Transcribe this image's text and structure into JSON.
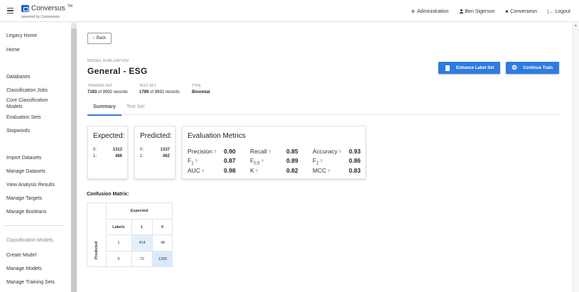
{
  "header": {
    "brand": "Conversus",
    "trademark": "TM",
    "powered_by": "powered by Converseon",
    "nav": [
      {
        "icon": "gear-icon",
        "glyph": "⚙",
        "label": "Administration"
      },
      {
        "icon": "user-icon",
        "glyph": "👤",
        "label": "Ben Sigerson"
      },
      {
        "icon": "briefcase-icon",
        "glyph": "■",
        "label": "Converseon"
      },
      {
        "icon": "logout-icon",
        "glyph": "[→",
        "label": "Logout"
      }
    ]
  },
  "sidebar": {
    "items": [
      {
        "label": "Legacy Home"
      },
      {
        "label": "Home"
      },
      {
        "label": "Databases"
      },
      {
        "label": "Classification Jobs"
      },
      {
        "label": "Core Classification Models"
      },
      {
        "label": "Evaluation Sets"
      },
      {
        "label": "Stopwords"
      },
      {
        "label": "Import Datasets"
      },
      {
        "label": "Manage Datasets"
      },
      {
        "label": "View Analysis Results"
      },
      {
        "label": "Manage Targets"
      },
      {
        "label": "Manage Booleans"
      },
      {
        "label": "Classification Models"
      },
      {
        "label": "Create Model"
      },
      {
        "label": "Manage Models"
      },
      {
        "label": "Manage Training Sets"
      }
    ]
  },
  "main": {
    "back_label": "Back",
    "eyebrow": "MODEL EVALUATION",
    "title": "General - ESG",
    "enhance_label": "Enhance Label Set",
    "continue_label": "Continue Train",
    "training": {
      "label": "TRAINING SET",
      "count": "7193",
      "rest": "of 8992 records"
    },
    "test": {
      "label": "TEST SET",
      "count": "1799",
      "rest": "of 8992 records"
    },
    "type": {
      "label": "TYPE",
      "value": "Binomial"
    },
    "tabs": [
      {
        "label": "Summary"
      },
      {
        "label": "Test Set"
      }
    ]
  },
  "expected": {
    "title": "Expected:",
    "rows": [
      {
        "k": "0:",
        "v": "1313"
      },
      {
        "k": "1:",
        "v": "486"
      }
    ]
  },
  "predicted": {
    "title": "Predicted:",
    "rows": [
      {
        "k": "0:",
        "v": "1337"
      },
      {
        "k": "1:",
        "v": "462"
      }
    ]
  },
  "metrics": {
    "title": "Evaluation Metrics",
    "help_glyph": "?",
    "precision": {
      "label": "Precision",
      "value": "0.90"
    },
    "recall": {
      "label": "Recall",
      "value": "0.85"
    },
    "accuracy": {
      "label": "Accuracy",
      "value": "0.93"
    },
    "f1": {
      "label": "F",
      "sub": "1",
      "value": "0.87"
    },
    "f05": {
      "label": "F",
      "sub": "0.5",
      "value": "0.89"
    },
    "f2": {
      "label": "F",
      "sub": "2",
      "value": "0.86"
    },
    "auc": {
      "label": "AUC",
      "value": "0.98"
    },
    "kappa": {
      "label": "K",
      "value": "0.82"
    },
    "mcc": {
      "label": "MCC",
      "value": "0.83"
    }
  },
  "confusion": {
    "title": "Confusion Matrix:",
    "expected_label": "Expected",
    "predicted_label": "Predicted",
    "labels_header": "Labels",
    "col1": "1",
    "col0": "0",
    "row1_label": "1",
    "row0_label": "0",
    "tp": "414",
    "fp": "48",
    "fn": "72",
    "tn": "1265"
  }
}
